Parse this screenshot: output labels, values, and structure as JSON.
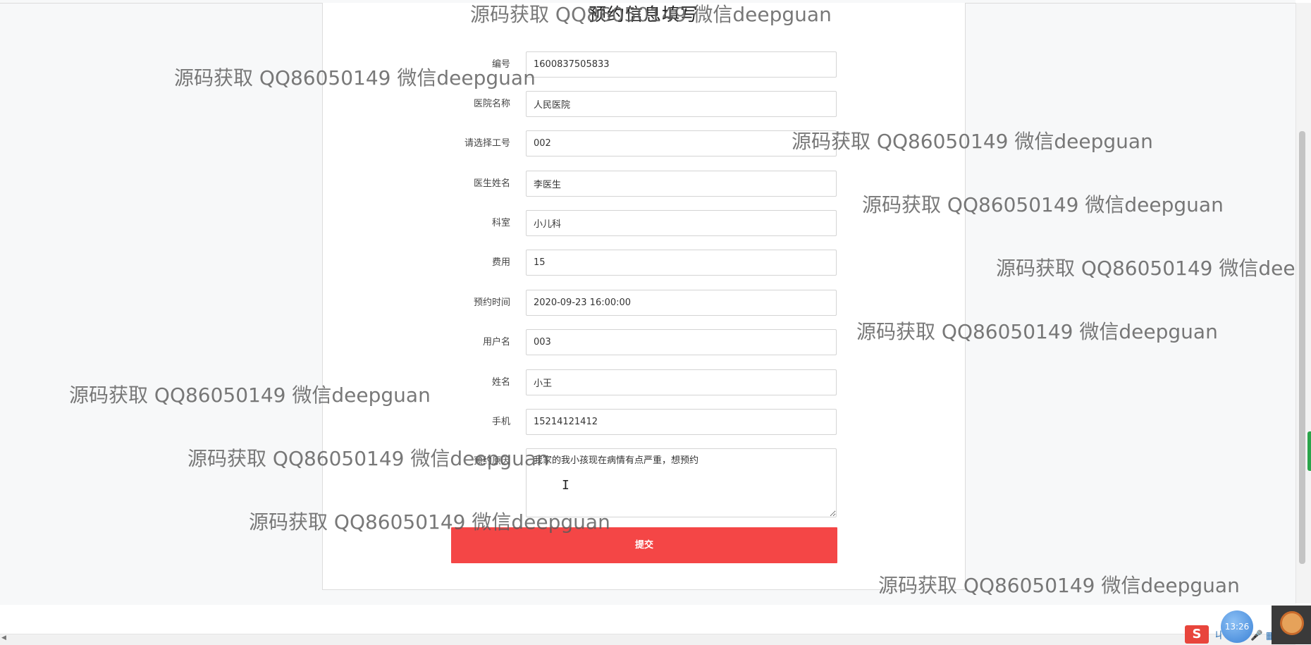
{
  "form": {
    "title": "预约信息填写",
    "fields": [
      {
        "label": "编号",
        "value": "1600837505833"
      },
      {
        "label": "医院名称",
        "value": "人民医院"
      },
      {
        "label": "请选择工号",
        "value": "002"
      },
      {
        "label": "医生姓名",
        "value": "李医生"
      },
      {
        "label": "科室",
        "value": "小儿科"
      },
      {
        "label": "费用",
        "value": "15"
      },
      {
        "label": "预约时间",
        "value": "2020-09-23 16:00:00"
      },
      {
        "label": "用户名",
        "value": "003"
      },
      {
        "label": "姓名",
        "value": "小王"
      },
      {
        "label": "手机",
        "value": "15214121412"
      }
    ],
    "notes": {
      "label": "预约原因",
      "value": "我家的我小孩现在病情有点严重，想预约"
    },
    "submit_label": "提交"
  },
  "watermark": {
    "text": "源码获取 QQ86050149 微信deepguan"
  },
  "taskbar": {
    "clock": "13:26",
    "ime_label": "S",
    "tray_glyphs": "ㄐ☺✎🎤▦"
  },
  "colors": {
    "submit": "#f44646",
    "background": "#f7f8f9",
    "card": "#ffffff"
  }
}
